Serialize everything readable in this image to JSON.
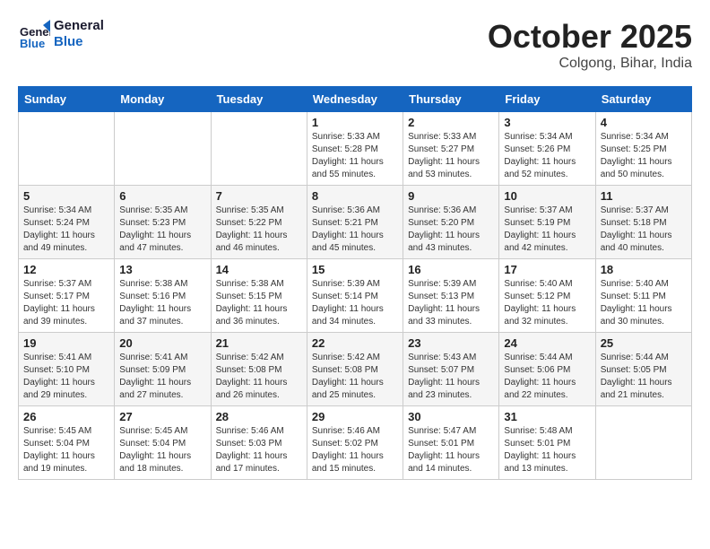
{
  "header": {
    "logo_line1": "General",
    "logo_line2": "Blue",
    "month": "October 2025",
    "location": "Colgong, Bihar, India"
  },
  "weekdays": [
    "Sunday",
    "Monday",
    "Tuesday",
    "Wednesday",
    "Thursday",
    "Friday",
    "Saturday"
  ],
  "weeks": [
    [
      {
        "day": "",
        "sunrise": "",
        "sunset": "",
        "daylight": ""
      },
      {
        "day": "",
        "sunrise": "",
        "sunset": "",
        "daylight": ""
      },
      {
        "day": "",
        "sunrise": "",
        "sunset": "",
        "daylight": ""
      },
      {
        "day": "1",
        "sunrise": "Sunrise: 5:33 AM",
        "sunset": "Sunset: 5:28 PM",
        "daylight": "Daylight: 11 hours and 55 minutes."
      },
      {
        "day": "2",
        "sunrise": "Sunrise: 5:33 AM",
        "sunset": "Sunset: 5:27 PM",
        "daylight": "Daylight: 11 hours and 53 minutes."
      },
      {
        "day": "3",
        "sunrise": "Sunrise: 5:34 AM",
        "sunset": "Sunset: 5:26 PM",
        "daylight": "Daylight: 11 hours and 52 minutes."
      },
      {
        "day": "4",
        "sunrise": "Sunrise: 5:34 AM",
        "sunset": "Sunset: 5:25 PM",
        "daylight": "Daylight: 11 hours and 50 minutes."
      }
    ],
    [
      {
        "day": "5",
        "sunrise": "Sunrise: 5:34 AM",
        "sunset": "Sunset: 5:24 PM",
        "daylight": "Daylight: 11 hours and 49 minutes."
      },
      {
        "day": "6",
        "sunrise": "Sunrise: 5:35 AM",
        "sunset": "Sunset: 5:23 PM",
        "daylight": "Daylight: 11 hours and 47 minutes."
      },
      {
        "day": "7",
        "sunrise": "Sunrise: 5:35 AM",
        "sunset": "Sunset: 5:22 PM",
        "daylight": "Daylight: 11 hours and 46 minutes."
      },
      {
        "day": "8",
        "sunrise": "Sunrise: 5:36 AM",
        "sunset": "Sunset: 5:21 PM",
        "daylight": "Daylight: 11 hours and 45 minutes."
      },
      {
        "day": "9",
        "sunrise": "Sunrise: 5:36 AM",
        "sunset": "Sunset: 5:20 PM",
        "daylight": "Daylight: 11 hours and 43 minutes."
      },
      {
        "day": "10",
        "sunrise": "Sunrise: 5:37 AM",
        "sunset": "Sunset: 5:19 PM",
        "daylight": "Daylight: 11 hours and 42 minutes."
      },
      {
        "day": "11",
        "sunrise": "Sunrise: 5:37 AM",
        "sunset": "Sunset: 5:18 PM",
        "daylight": "Daylight: 11 hours and 40 minutes."
      }
    ],
    [
      {
        "day": "12",
        "sunrise": "Sunrise: 5:37 AM",
        "sunset": "Sunset: 5:17 PM",
        "daylight": "Daylight: 11 hours and 39 minutes."
      },
      {
        "day": "13",
        "sunrise": "Sunrise: 5:38 AM",
        "sunset": "Sunset: 5:16 PM",
        "daylight": "Daylight: 11 hours and 37 minutes."
      },
      {
        "day": "14",
        "sunrise": "Sunrise: 5:38 AM",
        "sunset": "Sunset: 5:15 PM",
        "daylight": "Daylight: 11 hours and 36 minutes."
      },
      {
        "day": "15",
        "sunrise": "Sunrise: 5:39 AM",
        "sunset": "Sunset: 5:14 PM",
        "daylight": "Daylight: 11 hours and 34 minutes."
      },
      {
        "day": "16",
        "sunrise": "Sunrise: 5:39 AM",
        "sunset": "Sunset: 5:13 PM",
        "daylight": "Daylight: 11 hours and 33 minutes."
      },
      {
        "day": "17",
        "sunrise": "Sunrise: 5:40 AM",
        "sunset": "Sunset: 5:12 PM",
        "daylight": "Daylight: 11 hours and 32 minutes."
      },
      {
        "day": "18",
        "sunrise": "Sunrise: 5:40 AM",
        "sunset": "Sunset: 5:11 PM",
        "daylight": "Daylight: 11 hours and 30 minutes."
      }
    ],
    [
      {
        "day": "19",
        "sunrise": "Sunrise: 5:41 AM",
        "sunset": "Sunset: 5:10 PM",
        "daylight": "Daylight: 11 hours and 29 minutes."
      },
      {
        "day": "20",
        "sunrise": "Sunrise: 5:41 AM",
        "sunset": "Sunset: 5:09 PM",
        "daylight": "Daylight: 11 hours and 27 minutes."
      },
      {
        "day": "21",
        "sunrise": "Sunrise: 5:42 AM",
        "sunset": "Sunset: 5:08 PM",
        "daylight": "Daylight: 11 hours and 26 minutes."
      },
      {
        "day": "22",
        "sunrise": "Sunrise: 5:42 AM",
        "sunset": "Sunset: 5:08 PM",
        "daylight": "Daylight: 11 hours and 25 minutes."
      },
      {
        "day": "23",
        "sunrise": "Sunrise: 5:43 AM",
        "sunset": "Sunset: 5:07 PM",
        "daylight": "Daylight: 11 hours and 23 minutes."
      },
      {
        "day": "24",
        "sunrise": "Sunrise: 5:44 AM",
        "sunset": "Sunset: 5:06 PM",
        "daylight": "Daylight: 11 hours and 22 minutes."
      },
      {
        "day": "25",
        "sunrise": "Sunrise: 5:44 AM",
        "sunset": "Sunset: 5:05 PM",
        "daylight": "Daylight: 11 hours and 21 minutes."
      }
    ],
    [
      {
        "day": "26",
        "sunrise": "Sunrise: 5:45 AM",
        "sunset": "Sunset: 5:04 PM",
        "daylight": "Daylight: 11 hours and 19 minutes."
      },
      {
        "day": "27",
        "sunrise": "Sunrise: 5:45 AM",
        "sunset": "Sunset: 5:04 PM",
        "daylight": "Daylight: 11 hours and 18 minutes."
      },
      {
        "day": "28",
        "sunrise": "Sunrise: 5:46 AM",
        "sunset": "Sunset: 5:03 PM",
        "daylight": "Daylight: 11 hours and 17 minutes."
      },
      {
        "day": "29",
        "sunrise": "Sunrise: 5:46 AM",
        "sunset": "Sunset: 5:02 PM",
        "daylight": "Daylight: 11 hours and 15 minutes."
      },
      {
        "day": "30",
        "sunrise": "Sunrise: 5:47 AM",
        "sunset": "Sunset: 5:01 PM",
        "daylight": "Daylight: 11 hours and 14 minutes."
      },
      {
        "day": "31",
        "sunrise": "Sunrise: 5:48 AM",
        "sunset": "Sunset: 5:01 PM",
        "daylight": "Daylight: 11 hours and 13 minutes."
      },
      {
        "day": "",
        "sunrise": "",
        "sunset": "",
        "daylight": ""
      }
    ]
  ]
}
